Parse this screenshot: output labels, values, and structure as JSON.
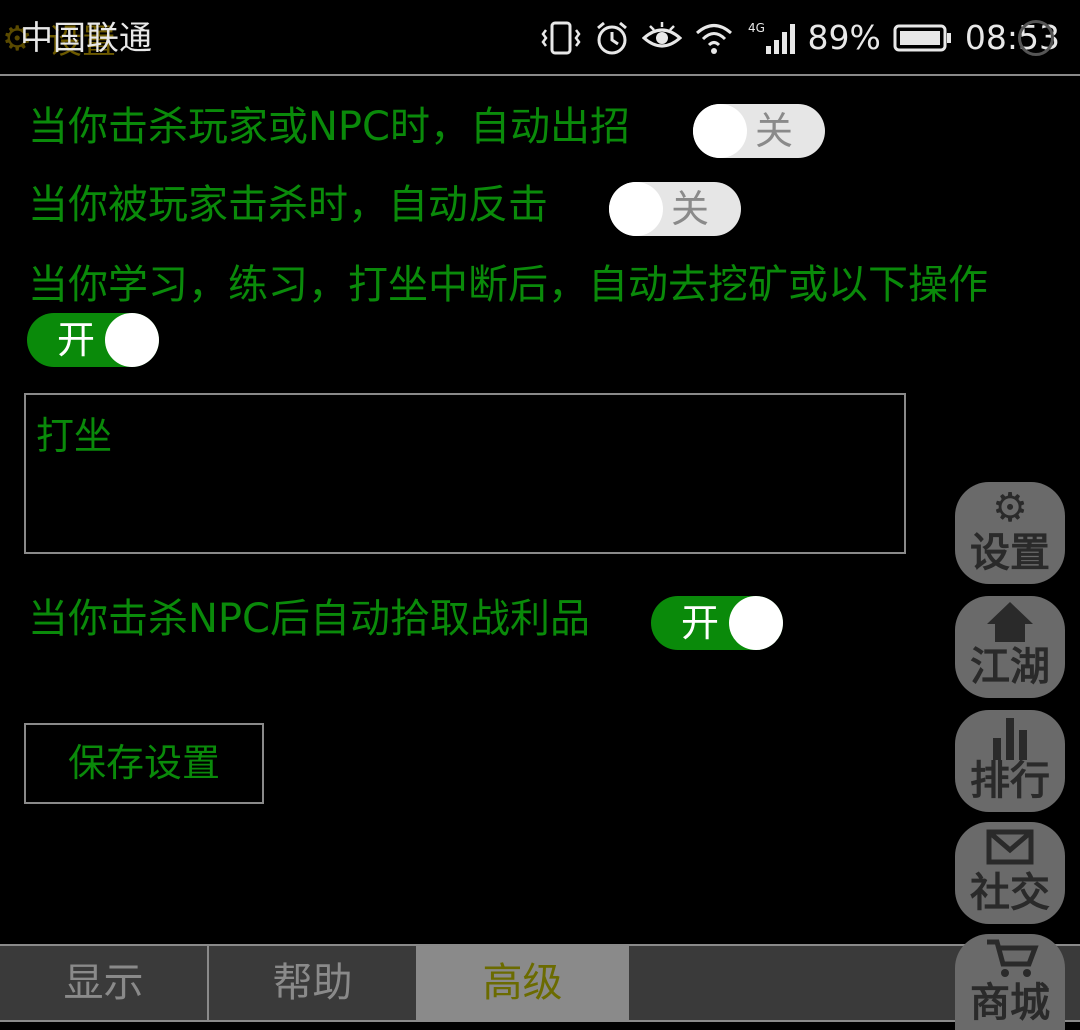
{
  "status_bar": {
    "carrier": "中国联通",
    "battery": "89%",
    "time": "08:53",
    "ghost_title": "设置"
  },
  "settings": {
    "row1_label": "当你击杀玩家或NPC时，自动出招",
    "row1_toggle": "关",
    "row2_label": "当你被玩家击杀时，自动反击",
    "row2_toggle": "关",
    "row3_label": "当你学习，练习，打坐中断后，自动去挖矿或以下操作",
    "row3_toggle": "开",
    "action_text": "打坐",
    "row4_label": "当你击杀NPC后自动拾取战利品",
    "row4_toggle": "开",
    "save_label": "保存设置"
  },
  "side_menu": {
    "settings": "设置",
    "jianghu": "江湖",
    "ranking": "排行",
    "social": "社交",
    "shop": "商城"
  },
  "tabs": {
    "display": "显示",
    "help": "帮助",
    "advanced": "高级"
  },
  "colors": {
    "accent_green": "#0a8a0a",
    "active_tab_text": "#6b6b00",
    "toggle_off": "#e6e6e6"
  }
}
